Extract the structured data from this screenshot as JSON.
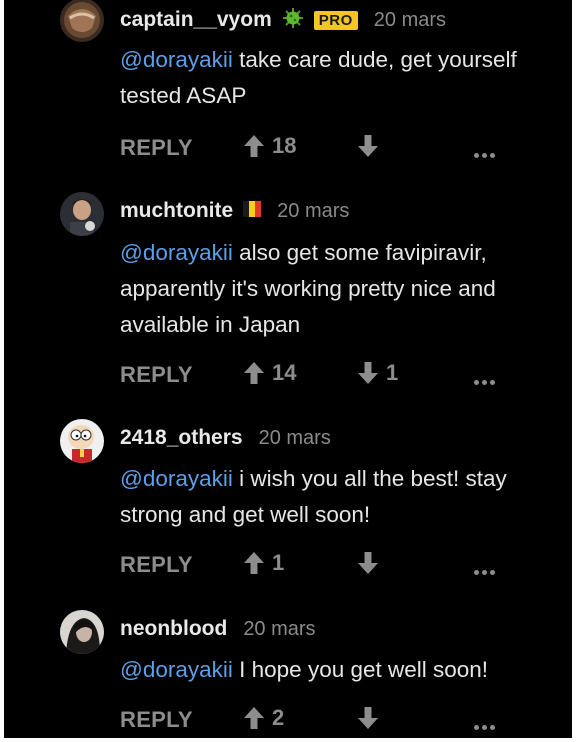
{
  "comments": [
    {
      "username": "captain__vyom",
      "flair_icon": "virus-icon",
      "badge": "PRO",
      "timestamp": "20 mars",
      "mention": "@dorayakii",
      "text": " take care dude, get yourself tested ASAP",
      "reply_label": "REPLY",
      "upvotes": "18",
      "downvotes": ""
    },
    {
      "username": "muchtonite",
      "flair_icon": "belgium-flag-icon",
      "timestamp": "20 mars",
      "mention": "@dorayakii",
      "text": " also get some favipiravir, apparently it's working pretty nice and available in Japan",
      "reply_label": "REPLY",
      "upvotes": "14",
      "downvotes": "1"
    },
    {
      "username": "2418_others",
      "timestamp": "20 mars",
      "mention": "@dorayakii",
      "text": " i wish you all the best! stay strong and get well soon!",
      "reply_label": "REPLY",
      "upvotes": "1",
      "downvotes": ""
    },
    {
      "username": "neonblood",
      "timestamp": "20 mars",
      "mention": "@dorayakii",
      "text": " I hope you get well soon!",
      "reply_label": "REPLY",
      "upvotes": "2",
      "downvotes": ""
    }
  ],
  "colors": {
    "background": "#000000",
    "mention": "#5d9fe6",
    "pro_badge": "#f3c623",
    "muted": "#8d8d8d"
  }
}
